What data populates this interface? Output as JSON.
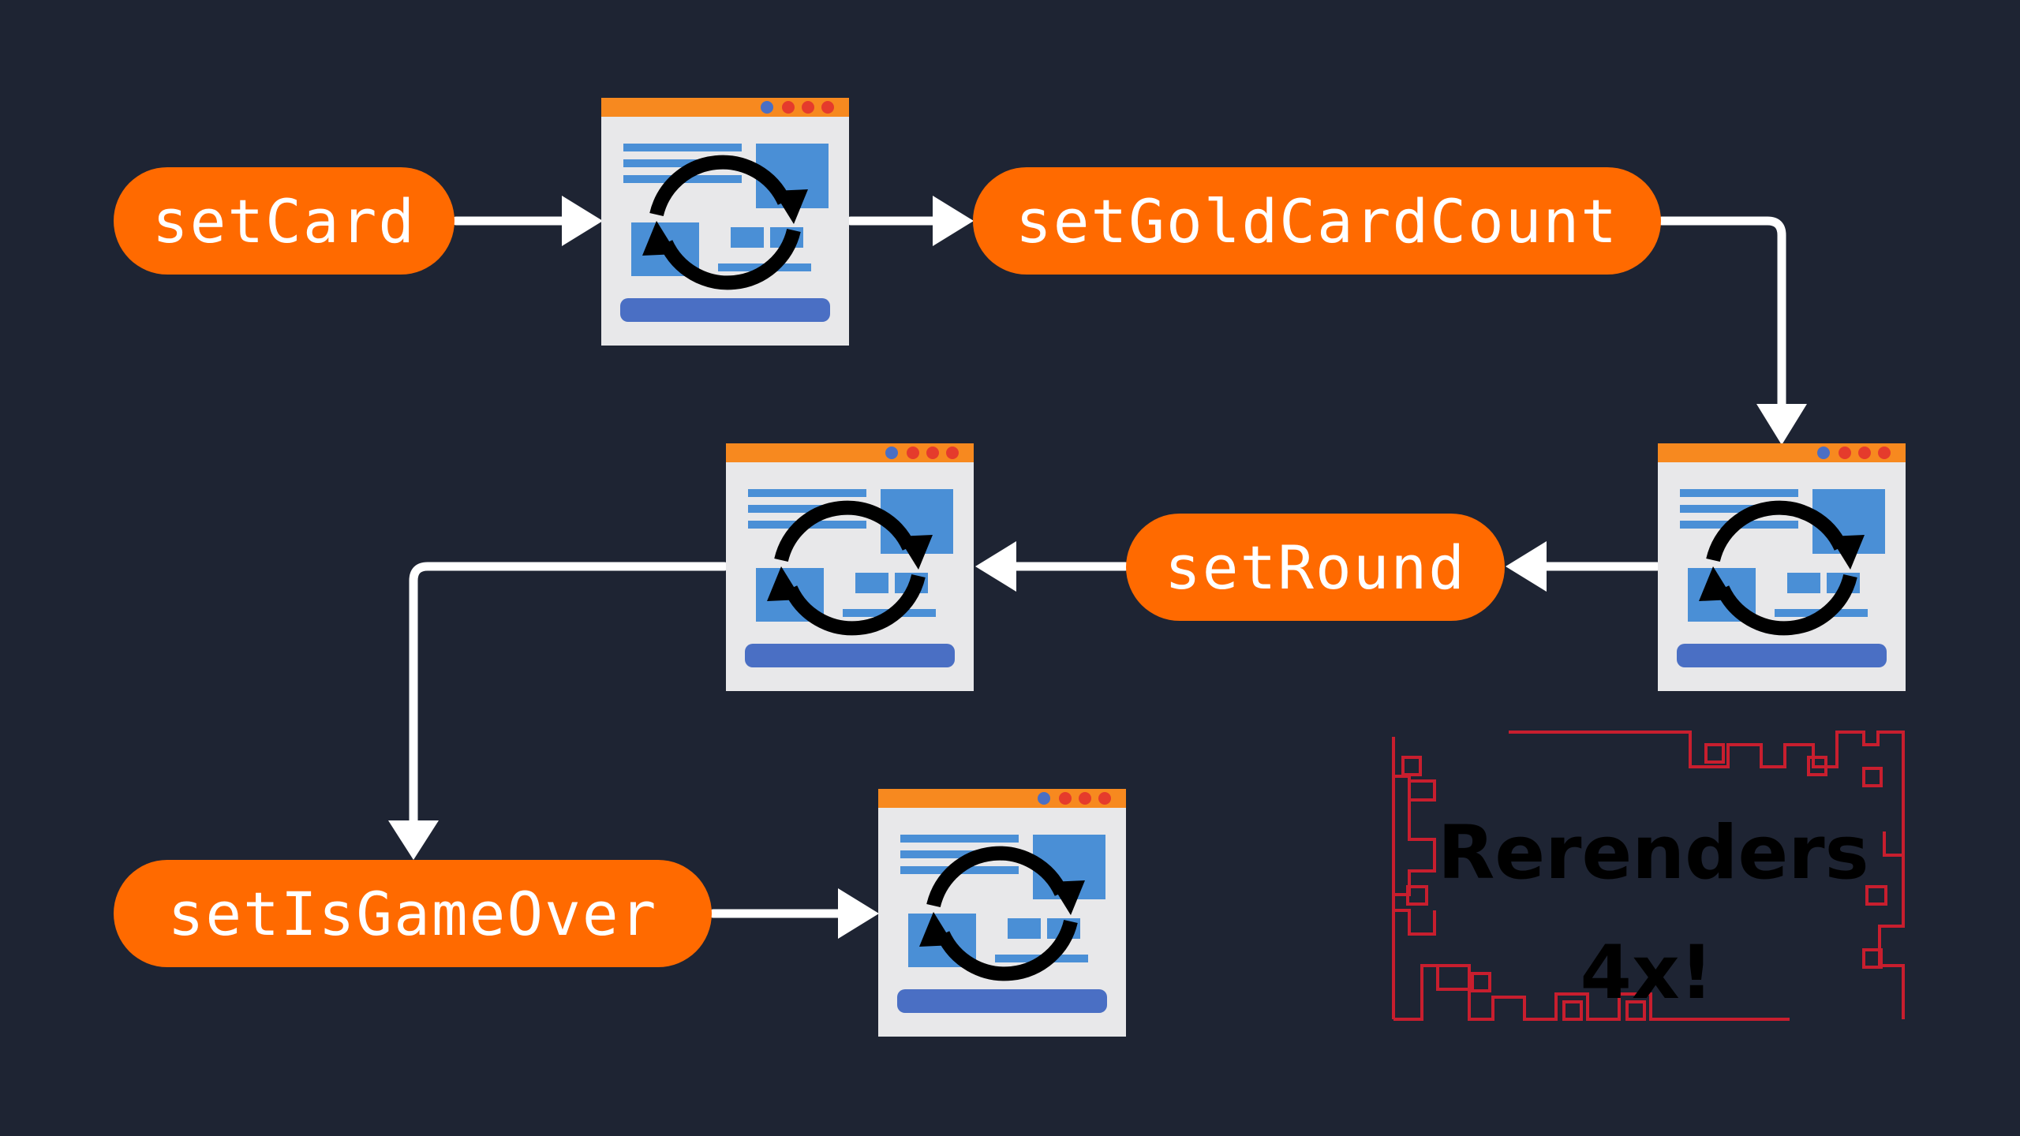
{
  "nodes": {
    "set_card": "setCard",
    "set_gold_card_count": "setGoldCardCount",
    "set_round": "setRound",
    "set_is_game_over": "setIsGameOver"
  },
  "note": "Rerenders\n4x!",
  "icons": {
    "rerender": "browser-window-refresh-icon",
    "arrow": "arrow-icon"
  },
  "colors": {
    "background": "#1e2433",
    "pill": "#ff6a00",
    "pill_text": "#ffffff",
    "window_bar": "#f7891f",
    "window_body": "#e8e8ea",
    "window_content": "#4a8fd6",
    "window_button": "#4a6fc4",
    "refresh": "#000000",
    "arrows": "#ffffff",
    "frame": "#c81e2e"
  }
}
